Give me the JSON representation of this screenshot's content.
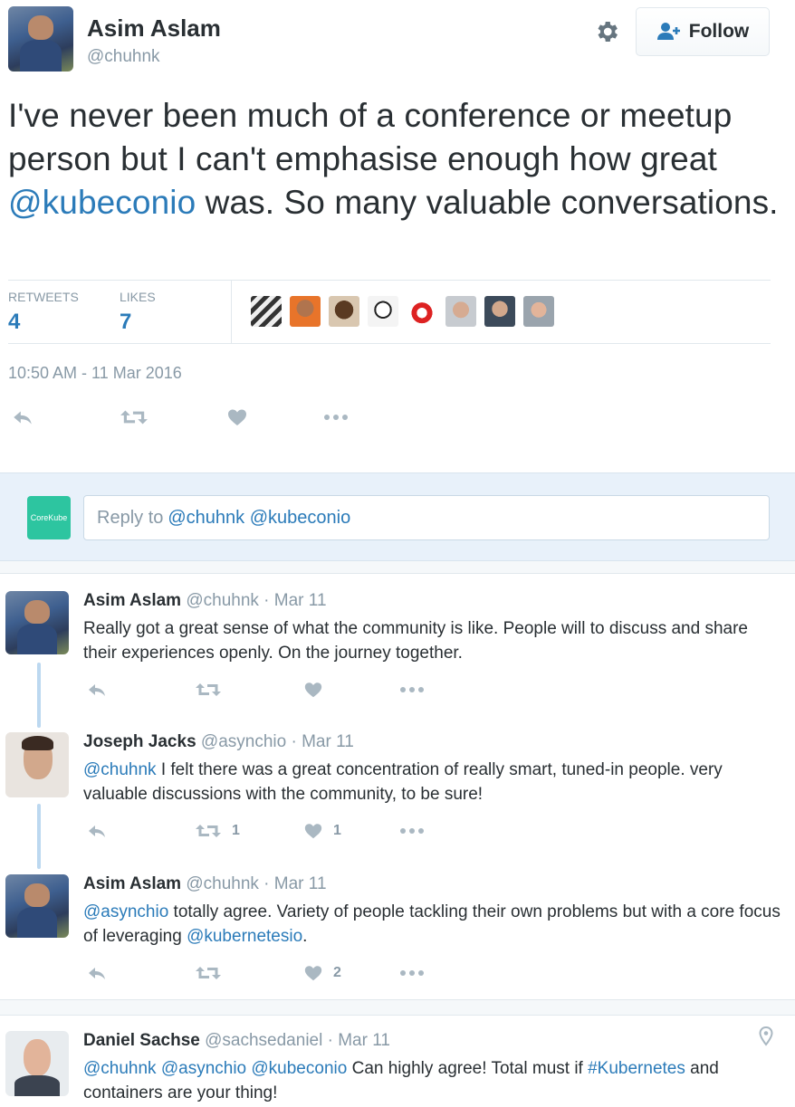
{
  "main_tweet": {
    "author_name": "Asim Aslam",
    "author_handle": "@chuhnk",
    "follow_label": "Follow",
    "text_part1": "I've never been much of a conference or meetup person but I can't emphasise enough how great ",
    "mention": "@kubeconio",
    "text_part2": " was. So many valuable conversations.",
    "retweets_label": "RETWEETS",
    "retweets_count": "4",
    "likes_label": "LIKES",
    "likes_count": "7",
    "timestamp": "10:50 AM - 11 Mar 2016",
    "liker_icons": [
      "clapperboard-avatar",
      "orange-avatar",
      "cartoon-avatar",
      "sketch-avatar",
      "tux-avatar",
      "bald-avatar",
      "smiling-avatar",
      "blond-avatar"
    ]
  },
  "reply_box": {
    "account_label": "CoreKube",
    "prefix": "Reply to ",
    "mentions": "@chuhnk @kubeconio"
  },
  "replies": [
    {
      "name": "Asim Aslam",
      "handle": "@chuhnk · Mar 11",
      "text": "Really got a great sense of what the community is like. People will to discuss and share their experiences openly. On the journey together.",
      "retweet_count": "",
      "like_count": ""
    },
    {
      "name": "Joseph Jacks",
      "handle": "@asynchio · Mar 11",
      "mention": "@chuhnk",
      "text": " I felt there was a great concentration of really smart, tuned-in people. very valuable discussions with the community, to be sure!",
      "retweet_count": "1",
      "like_count": "1"
    },
    {
      "name": "Asim Aslam",
      "handle": "@chuhnk · Mar 11",
      "mention": "@asynchio",
      "text": " totally agree. Variety of people tackling their own problems but with a core focus of leveraging ",
      "mention2": "@kubernetesio",
      "text2": ".",
      "retweet_count": "",
      "like_count": "2"
    },
    {
      "name": "Daniel Sachse",
      "handle": "@sachsedaniel · Mar 11",
      "mentions": "@chuhnk @asynchio @kubeconio",
      "text": " Can highly agree! Total must if ",
      "hashtag": "#Kubernetes",
      "text2": " and containers are your thing!"
    }
  ],
  "colors": {
    "link": "#2b7bb9",
    "muted": "#8899a6",
    "icon": "#aab8c2",
    "reply_bar": "#e8f1fa",
    "corekube": "#2dc5a0"
  }
}
